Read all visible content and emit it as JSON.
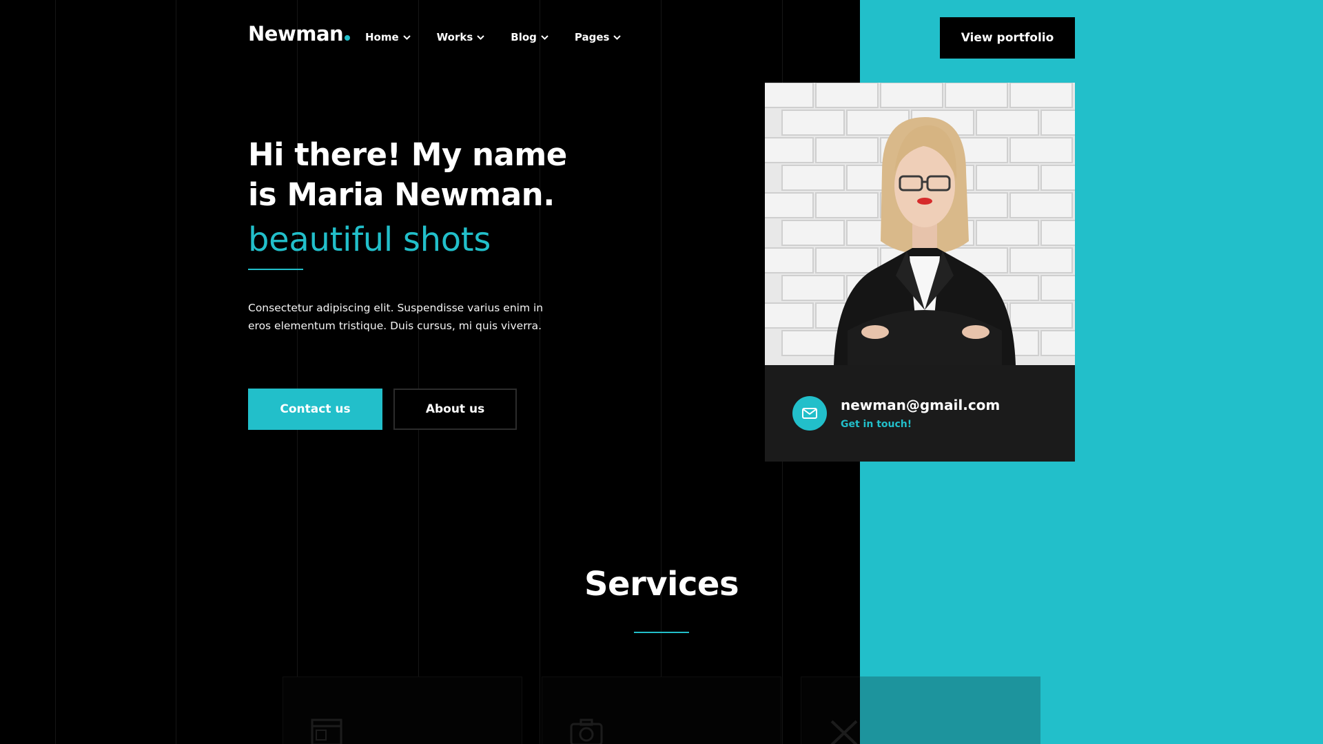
{
  "colors": {
    "accent": "#22bfca",
    "background": "#000000",
    "card": "#1b1b1b"
  },
  "header": {
    "logo": "Newman",
    "nav": [
      {
        "label": "Home",
        "icon": "chevron-down-icon"
      },
      {
        "label": "Works",
        "icon": "chevron-down-icon"
      },
      {
        "label": "Blog",
        "icon": "chevron-down-icon"
      },
      {
        "label": "Pages",
        "icon": "chevron-down-icon"
      }
    ],
    "cta_label": "View portfolio"
  },
  "hero": {
    "title": "Hi there! My name is Maria Newman.",
    "rotating_word": "beautiful shots",
    "description": "Consectetur adipiscing elit. Suspendisse varius enim in eros elementum tristique. Duis cursus, mi quis viverra.",
    "primary_button": "Contact us",
    "secondary_button": "About us"
  },
  "profile": {
    "email": "newman@gmail.com",
    "cta": "Get in touch!",
    "icon": "mail-icon"
  },
  "services": {
    "title": "Services",
    "cards": [
      {
        "icon": "browser-window-icon"
      },
      {
        "icon": "camera-icon"
      },
      {
        "icon": "pencil-ruler-icon"
      }
    ]
  }
}
